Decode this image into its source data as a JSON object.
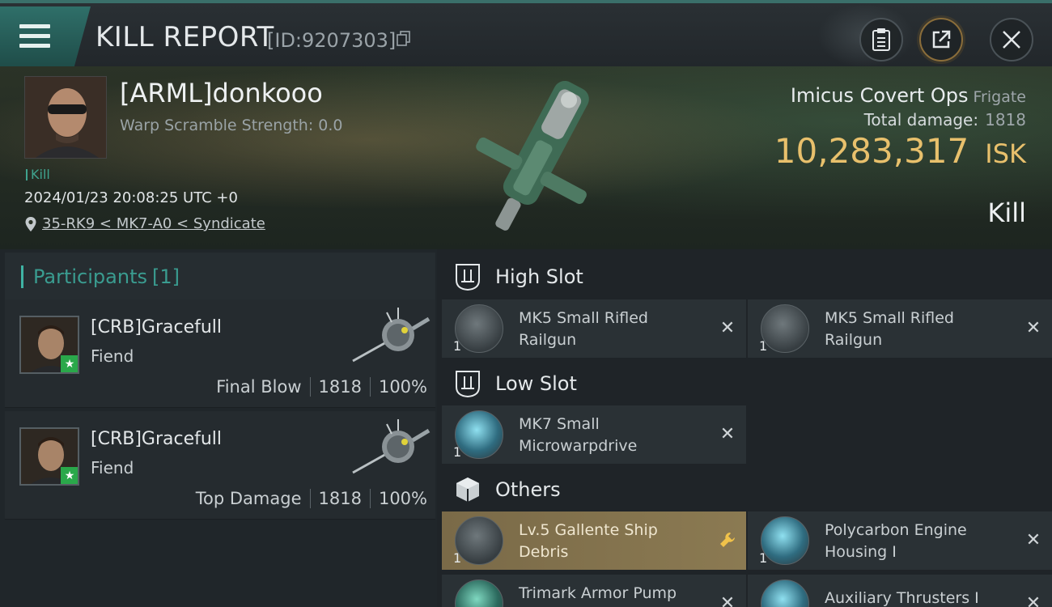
{
  "header": {
    "title": "KILL REPORT",
    "report_id": "[ID:9207303]",
    "icons": [
      "menu-icon",
      "copy-icon",
      "clipboard-icon",
      "share-icon",
      "close-icon"
    ]
  },
  "victim": {
    "name": "[ARML]donkooo",
    "warp_scramble": "Warp Scramble Strength: 0.0",
    "tag": "Kill",
    "datetime": "2024/01/23 20:08:25 UTC +0",
    "location": "35-RK9 < MK7-A0 < Syndicate",
    "ship_name": "Imicus Covert Ops",
    "ship_class": "Frigate",
    "total_damage_label": "Total damage:",
    "total_damage": "1818",
    "isk_value": "10,283,317",
    "isk_unit": "ISK",
    "result": "Kill"
  },
  "participants": {
    "label": "Participants",
    "count": "[1]",
    "rows": [
      {
        "name": "[CRB]Gracefull",
        "ship": "Fiend",
        "role": "Final Blow",
        "damage": "1818",
        "percent": "100%"
      },
      {
        "name": "[CRB]Gracefull",
        "ship": "Fiend",
        "role": "Top Damage",
        "damage": "1818",
        "percent": "100%"
      }
    ]
  },
  "slots": {
    "high": {
      "label": "High Slot",
      "modules": [
        {
          "name": "MK5 Small Rifled Railgun",
          "qty": "1"
        },
        {
          "name": "MK5 Small Rifled Railgun",
          "qty": "1"
        }
      ]
    },
    "low": {
      "label": "Low Slot",
      "modules": [
        {
          "name": "MK7 Small Microwarpdrive",
          "qty": "1"
        }
      ]
    },
    "others": {
      "label": "Others",
      "modules": [
        {
          "name": "Lv.5 Gallente Ship Debris",
          "qty": "1",
          "highlight": true
        },
        {
          "name": "Polycarbon Engine Housing I",
          "qty": "1"
        },
        {
          "name": "Trimark Armor Pump",
          "qty": ""
        },
        {
          "name": "Auxiliary Thrusters I",
          "qty": ""
        }
      ]
    }
  },
  "colors": {
    "accent_teal": "#3fb3a4",
    "isk_gold": "#e8c06c",
    "highlight_gold": "#8b7a52",
    "badge_green": "#2aa84a"
  }
}
